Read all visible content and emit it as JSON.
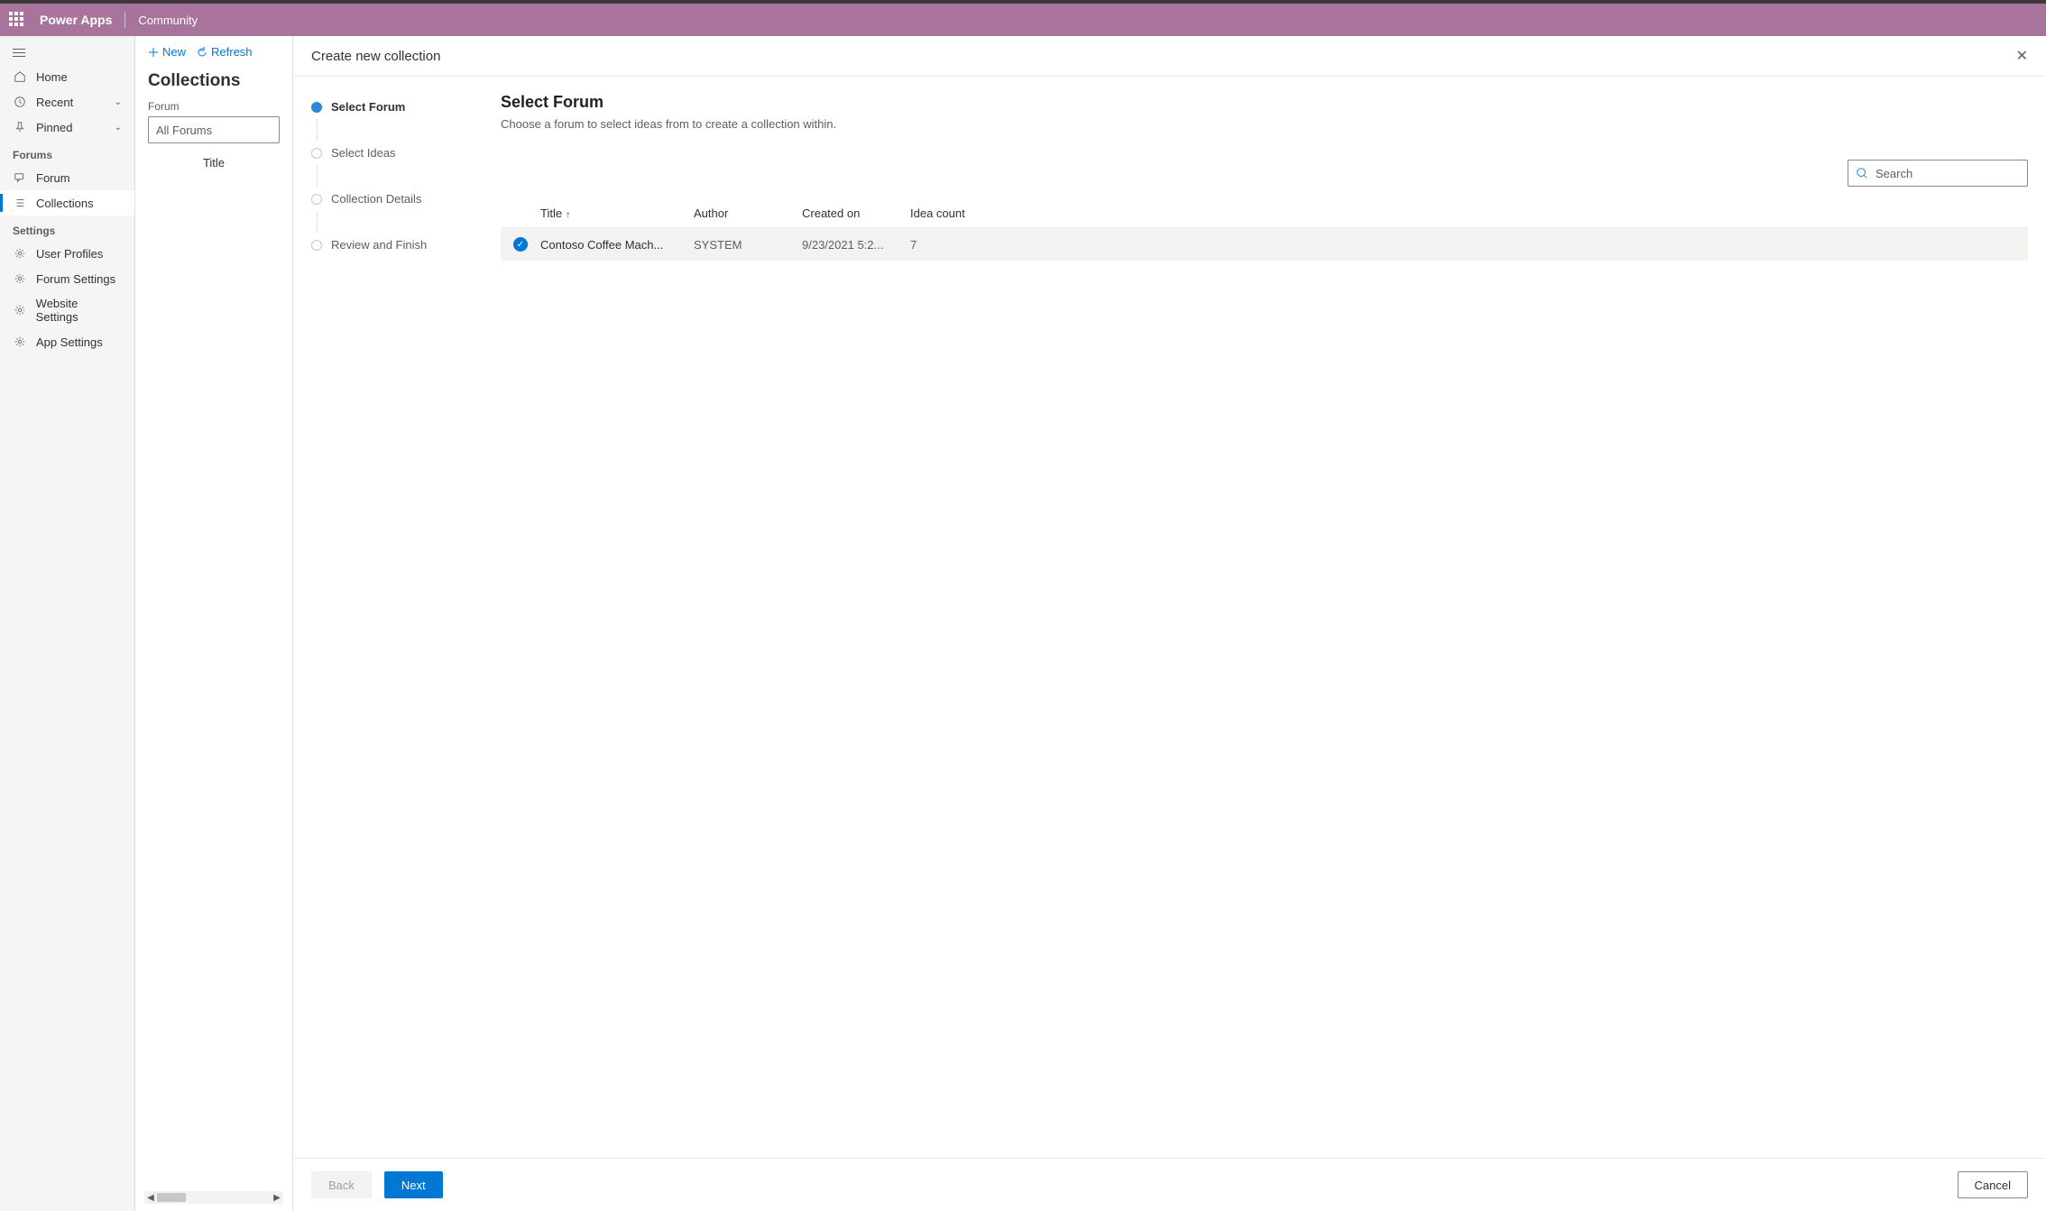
{
  "header": {
    "app": "Power Apps",
    "area": "Community"
  },
  "nav": {
    "home": "Home",
    "recent": "Recent",
    "pinned": "Pinned",
    "section_forums": "Forums",
    "forum": "Forum",
    "collections": "Collections",
    "section_settings": "Settings",
    "user_profiles": "User Profiles",
    "forum_settings": "Forum Settings",
    "website_settings": "Website Settings",
    "app_settings": "App Settings"
  },
  "panel": {
    "new": "New",
    "refresh": "Refresh",
    "title": "Collections",
    "forum_label": "Forum",
    "forum_value": "All Forums",
    "title_col": "Title"
  },
  "dialog": {
    "title": "Create new collection",
    "steps": [
      "Select Forum",
      "Select Ideas",
      "Collection Details",
      "Review and Finish"
    ],
    "content_title": "Select Forum",
    "content_subtitle": "Choose a forum to select ideas from to create a collection within.",
    "search_placeholder": "Search",
    "table": {
      "headers": {
        "title": "Title",
        "author": "Author",
        "created": "Created on",
        "ideas": "Idea count"
      },
      "rows": [
        {
          "title": "Contoso Coffee Mach...",
          "author": "SYSTEM",
          "created": "9/23/2021 5:2...",
          "ideas": "7",
          "selected": true
        }
      ]
    },
    "footer": {
      "back": "Back",
      "next": "Next",
      "cancel": "Cancel"
    }
  }
}
